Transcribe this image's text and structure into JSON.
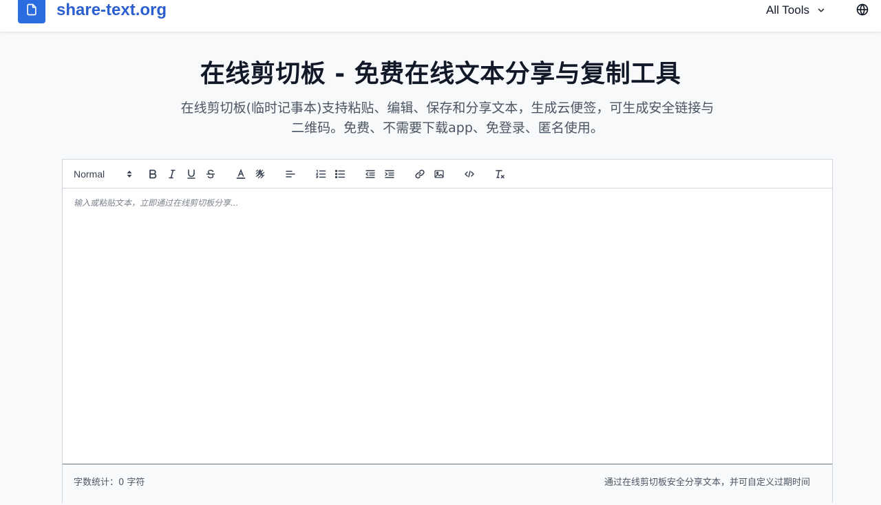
{
  "header": {
    "brand": "share-text.org",
    "tools_label": "All Tools",
    "icons": [
      "file-icon",
      "chevron-down-icon",
      "globe-icon"
    ]
  },
  "hero": {
    "title": "在线剪切板 - 免费在线文本分享与复制工具",
    "subtitle": "在线剪切板(临时记事本)支持粘贴、编辑、保存和分享文本，生成云便签，可生成安全链接与二维码。免费、不需要下载app、免登录、匿名使用。"
  },
  "editor": {
    "format_select": "Normal",
    "toolbar_buttons": [
      "bold",
      "italic",
      "underline",
      "strike",
      "text-color",
      "background-color",
      "align",
      "ordered-list",
      "bullet-list",
      "outdent",
      "indent",
      "link",
      "image",
      "code",
      "clear-format"
    ],
    "placeholder": "输入或粘贴文本，立即通过在线剪切板分享...",
    "value": "",
    "char_count": "字数统计：0 字符",
    "footer_note": "通过在线剪切板安全分享文本，并可自定义过期时间"
  },
  "colors": {
    "brand": "#2b5fcf",
    "logo_bg": "#2b6ce0",
    "page_bg": "#f8f9fb"
  }
}
